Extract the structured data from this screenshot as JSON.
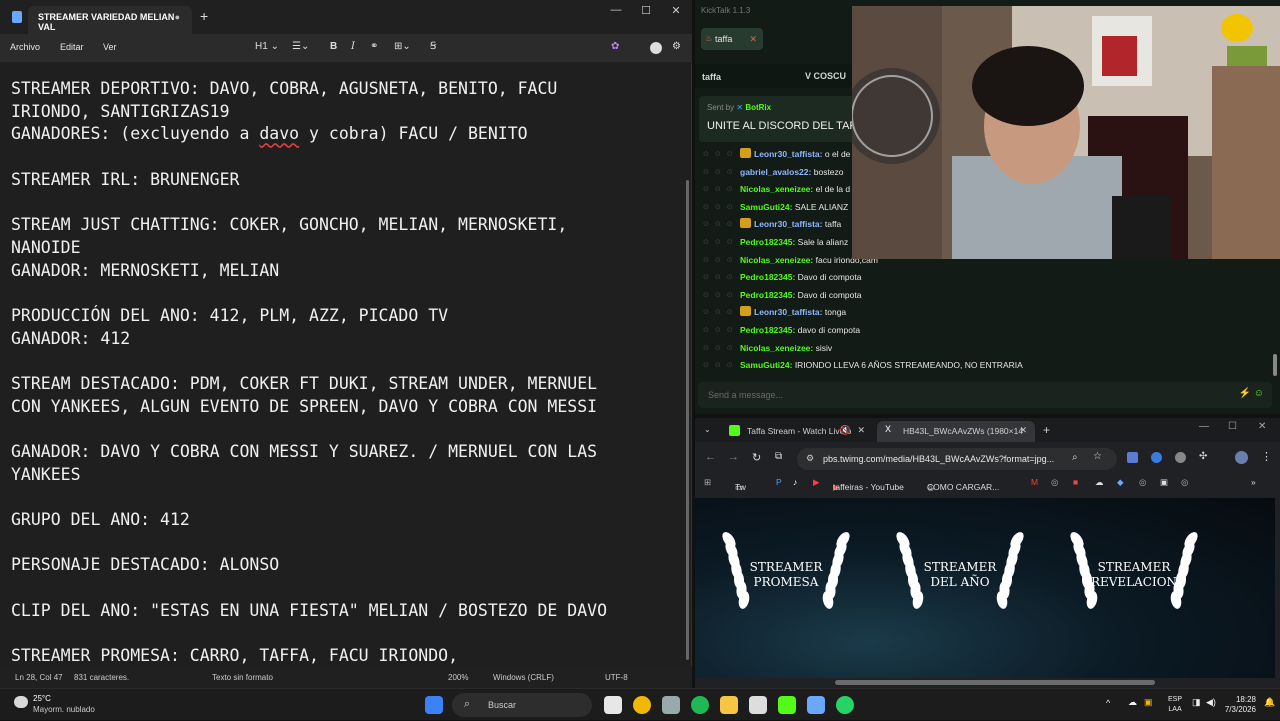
{
  "notepad": {
    "tab_title": "STREAMER VARIEDAD MELIAN VAL",
    "menu": {
      "archivo": "Archivo",
      "editar": "Editar",
      "ver": "Ver",
      "heading": "H1"
    },
    "lines": [
      "STREAMER DEPORTIVO: DAVO, COBRA, AGUSNETA, BENITO, FACU",
      "IRIONDO, SANTIGRIZAS19",
      "GANADORES: (excluyendo a davo y cobra) FACU / BENITO",
      "",
      "STREAMER IRL: BRUNENGER",
      "",
      "STREAM JUST CHATTING: COKER, GONCHO, MELIAN, MERNOSKETI,",
      "NANOIDE",
      "GANADOR: MERNOSKETI, MELIAN",
      "",
      "PRODUCCIÓN DEL ANO: 412, PLM, AZZ, PICADO TV",
      "GANADOR: 412",
      "",
      "STREAM DESTACADO: PDM, COKER FT DUKI, STREAM UNDER, MERNUEL",
      "CON YANKEES, ALGUN EVENTO DE SPREEN, DAVO Y COBRA CON MESSI",
      "",
      "GANADOR: DAVO Y COBRA CON MESSI Y SUAREZ. / MERNUEL CON LAS",
      "YANKEES",
      "",
      "GRUPO DEL ANO: 412",
      "",
      "PERSONAJE DESTACADO: ALONSO",
      "",
      "CLIP DEL ANO: \"ESTAS EN UNA FIESTA\" MELIAN / BOSTEZO DE DAVO",
      "",
      "STREAMER PROMESA: CARRO, TAFFA, FACU IRIONDO,"
    ],
    "spell_line3_prefix": "GANADORES: (excluyendo a ",
    "spell_word": "davo",
    "spell_line3_suffix": " y cobra) FACU / BENITO",
    "status": {
      "position": "Ln 28, Col 47",
      "chars": "831 caracteres.",
      "format": "Texto sin formato",
      "zoom": "200%",
      "eol": "Windows (CRLF)",
      "encoding": "UTF-8"
    }
  },
  "chat": {
    "app_title": "KickTalk 1.1.3",
    "tab_label": "taffa",
    "subbar": {
      "channel": "taffa",
      "other": "COSCU"
    },
    "pinned": {
      "sent_by_prefix": "Sent by",
      "sender": "BotRix",
      "message": "UNITE AL DISCORD DEL TAF"
    },
    "messages": [
      {
        "user": "Leonr30_taffista:",
        "text": "o el de",
        "color": "#8fb8ff",
        "badge": true
      },
      {
        "user": "gabriel_avalos22:",
        "text": "bostezo",
        "color": "#8fb8ff",
        "badge": false
      },
      {
        "user": "Nicolas_xeneizee:",
        "text": "el de la d",
        "color": "#53fc18",
        "badge": false
      },
      {
        "user": "SamuGuti24:",
        "text": "SALE ALIANZ",
        "color": "#53fc18",
        "badge": false
      },
      {
        "user": "Leonr30_taffista:",
        "text": "taffa",
        "color": "#8fb8ff",
        "badge": true
      },
      {
        "user": "Pedro182345:",
        "text": "Sale la alianz",
        "color": "#53fc18",
        "badge": false
      },
      {
        "user": "Nicolas_xeneizee:",
        "text": "facu iriondo,cam",
        "color": "#53fc18",
        "badge": false
      },
      {
        "user": "Pedro182345:",
        "text": "Davo di compota",
        "color": "#53fc18",
        "badge": false
      },
      {
        "user": "Pedro182345:",
        "text": "Davo di compota",
        "color": "#53fc18",
        "badge": false
      },
      {
        "user": "Leonr30_taffista:",
        "text": "tonga",
        "color": "#8fb8ff",
        "badge": true
      },
      {
        "user": "Pedro182345:",
        "text": "davo di compota",
        "color": "#53fc18",
        "badge": false
      },
      {
        "user": "Nicolas_xeneizee:",
        "text": "sisiv",
        "color": "#53fc18",
        "badge": false
      },
      {
        "user": "SamuGuti24:",
        "text": "IRIONDO LLEVA 6 AÑOS STREAMEANDO, NO ENTRARIA",
        "color": "#53fc18",
        "badge": false
      }
    ],
    "input_placeholder": "Send a message..."
  },
  "chrome": {
    "tabs": [
      {
        "label": "Taffa Stream - Watch Live o",
        "fav_color": "#53fc18"
      },
      {
        "label": "HB43L_BWcAAvZWs (1980×14",
        "fav_color": "#ffffff"
      }
    ],
    "url": "pbs.twimg.com/media/HB43L_BWcAAvZWs?format=jpg...",
    "bookmarks": [
      "Tw",
      "taffeiras - YouTube",
      "COMO CARGAR..."
    ],
    "awards": [
      {
        "line1": "STREAMER",
        "line2": "PROMESA"
      },
      {
        "line1": "STREAMER",
        "line2": "DEL AÑO"
      },
      {
        "line1": "STREAMER",
        "line2": "REVELACION"
      }
    ]
  },
  "taskbar": {
    "weather_temp": "25°C",
    "weather_desc": "Mayorm. nublado",
    "search_label": "Buscar",
    "lang_top": "ESP",
    "lang_bottom": "LAA",
    "time": "18:28",
    "date": "7/3/2026"
  }
}
